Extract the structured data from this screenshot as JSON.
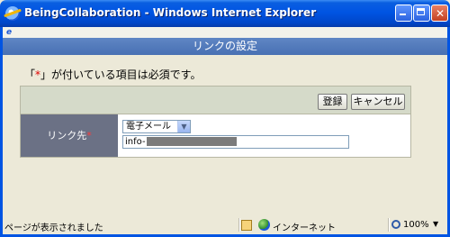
{
  "window": {
    "title": "BeingCollaboration - Windows Internet Explorer",
    "close_glyph": "✕"
  },
  "page": {
    "header_title": "リンクの設定",
    "required_note_prefix": "「",
    "required_mark": "*",
    "required_note_suffix": "」が付いている項目は必須です。"
  },
  "toolbar": {
    "save_label": "登録",
    "cancel_label": "キャンセル"
  },
  "form": {
    "link_label": "リンク先",
    "link_required_mark": "*",
    "type_select_value": "電子メール",
    "address_value": "info-"
  },
  "statusbar": {
    "status_text": "ページが表示されました",
    "zone_text": "インターネット",
    "zoom_text": "100%"
  },
  "icons": {
    "app": "internet-explorer-icon",
    "minimize": "minimize-icon",
    "maximize": "maximize-icon",
    "close": "close-icon",
    "page": "page-icon",
    "protected_mode": "lock-icon",
    "zone": "globe-icon",
    "zoom": "zoom-icon",
    "dropdown": "chevron-down-icon"
  },
  "colors": {
    "titlebar": "#0054e3",
    "header": "#5077b8",
    "label_cell": "#6b7185",
    "required": "#e00000",
    "toolbar": "#d5dac9"
  }
}
